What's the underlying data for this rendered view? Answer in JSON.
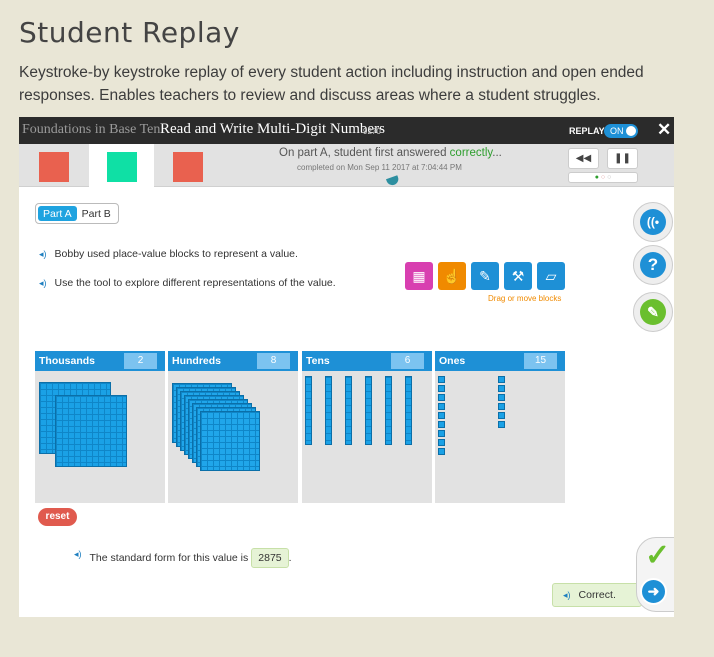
{
  "page": {
    "title": "Student Replay",
    "description": "Keystroke-by keystroke replay of every student action including instruction and open ended responses. Enables teachers to review and discuss areas where a student struggles."
  },
  "topbar": {
    "brand": "Foundations in Base Ten",
    "lesson_title": "Read and Write Multi-Digit Numbers",
    "lesson_id": "9270",
    "replay_label": "REPLAY",
    "toggle_label": "ON",
    "close_icon": "close-icon"
  },
  "status": {
    "part_colors": [
      "#e9614f",
      "#0fe0a5",
      "#e9614f"
    ],
    "answer_prefix": "On part A, student first answered ",
    "answer_highlight": "correctly",
    "answer_suffix": "...",
    "completed": "completed on Mon Sep 11 2017 at 7:04:44 PM",
    "rewind_icon": "rewind-icon",
    "pause_icon": "pause-icon"
  },
  "tabs": [
    {
      "label": "Part A",
      "active": true
    },
    {
      "label": "Part B",
      "active": false
    }
  ],
  "side_buttons": [
    "instruction-icon",
    "help-icon",
    "glossary-icon"
  ],
  "prompts": [
    "Bobby used place-value blocks to represent a value.",
    "Use the tool to explore different representations of the value."
  ],
  "tools": {
    "icons": [
      "grid-icon",
      "pointer-hand-icon",
      "pen-icon",
      "hammer-icon",
      "eraser-icon"
    ],
    "colors": [
      "#d83fb0",
      "#f08a00",
      "#1e90d6",
      "#1e90d6",
      "#1e90d6"
    ],
    "caption": "Drag or move blocks"
  },
  "columns": [
    {
      "name": "Thousands",
      "count": "2"
    },
    {
      "name": "Hundreds",
      "count": "8"
    },
    {
      "name": "Tens",
      "count": "6"
    },
    {
      "name": "Ones",
      "count": "15"
    }
  ],
  "reset_label": "reset",
  "standard_form": {
    "label": "The standard form for this value is",
    "value": "2875",
    "suffix": "."
  },
  "feedback": {
    "label": "Correct.",
    "check_icon": "check-icon",
    "next_icon": "arrow-right-icon"
  },
  "colors": {
    "accent": "#1e90d6",
    "correct": "#6abf2e",
    "reset": "#e05a4e"
  }
}
